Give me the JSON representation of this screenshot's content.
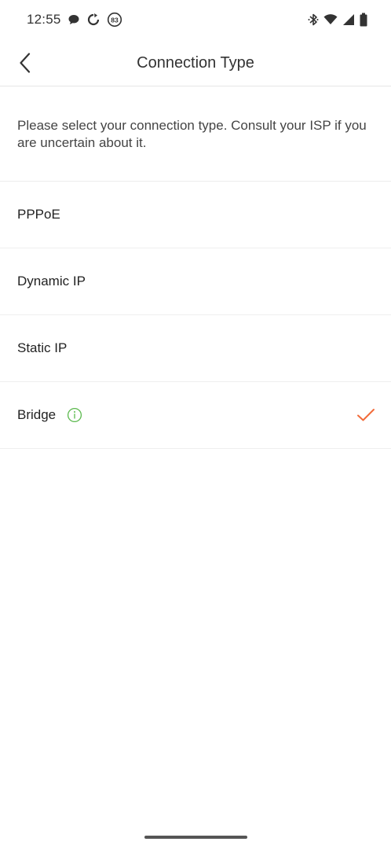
{
  "status_bar": {
    "time": "12:55",
    "notification_count": "83",
    "icons": [
      "chat-bubble-icon",
      "sync-icon",
      "badge-icon",
      "bluetooth-icon",
      "wifi-icon",
      "signal-icon",
      "battery-icon"
    ]
  },
  "app_bar": {
    "title": "Connection Type",
    "back_icon": "chevron-left-icon"
  },
  "description": "Please select your connection type. Consult your ISP if you are uncertain about it.",
  "options": [
    {
      "label": "PPPoE",
      "selected": false,
      "has_info": false
    },
    {
      "label": "Dynamic IP",
      "selected": false,
      "has_info": false
    },
    {
      "label": "Static IP",
      "selected": false,
      "has_info": false
    },
    {
      "label": "Bridge",
      "selected": true,
      "has_info": true
    }
  ],
  "colors": {
    "accent_check": "#f26b3a",
    "info_green": "#5bb94d",
    "divider": "#ececec"
  }
}
